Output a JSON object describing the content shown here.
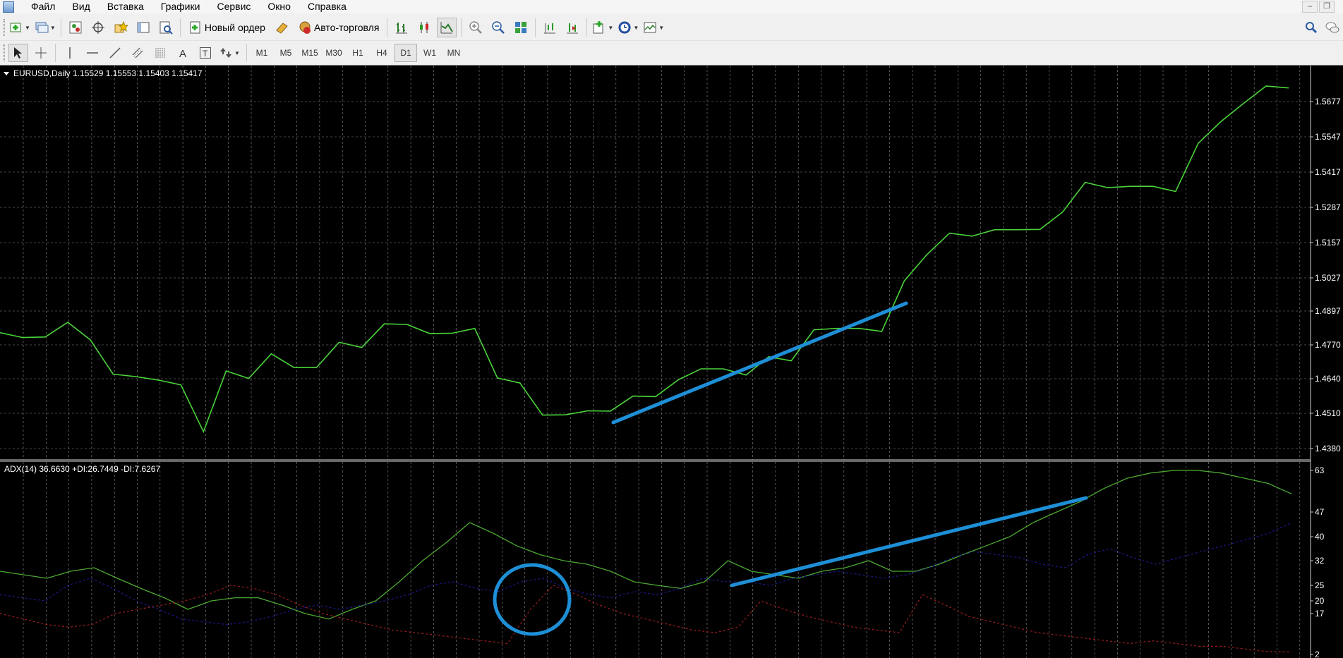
{
  "menu": {
    "items": [
      "Файл",
      "Вид",
      "Вставка",
      "Графики",
      "Сервис",
      "Окно",
      "Справка"
    ]
  },
  "toolbar": {
    "new_order_label": "Новый ордер",
    "auto_trading_label": "Авто-торговля"
  },
  "timeframes": [
    "M1",
    "M5",
    "M15",
    "M30",
    "H1",
    "H4",
    "D1",
    "W1",
    "MN"
  ],
  "active_timeframe": "D1",
  "price_panel": {
    "header": "EURUSD,Daily  1.15529 1.15553 1.15403 1.15417",
    "line_color": "#4ad43a",
    "trendline_color": "#1e8fd6"
  },
  "adx_panel": {
    "header": "ADX(14) 36.6630 +DI:26.7449 -DI:7.6267",
    "adx_color": "#4ca832",
    "plus_di_color": "#1a1a8c",
    "minus_di_color": "#9c1d1d"
  },
  "chart_data": [
    {
      "type": "line",
      "title": "EURUSD,Daily",
      "y_ticks": [
        "1.5677",
        "1.5547",
        "1.5417",
        "1.5287",
        "1.5157",
        "1.5027",
        "1.4897",
        "1.4770",
        "1.4640",
        "1.4510",
        "1.4380"
      ],
      "ylim": [
        1.438,
        1.5677
      ],
      "series": [
        {
          "name": "EURUSD",
          "values": [
            1.4813,
            1.4795,
            1.4797,
            1.4852,
            1.4786,
            1.4658,
            1.4649,
            1.4636,
            1.4618,
            1.4443,
            1.467,
            1.4642,
            1.4734,
            1.4683,
            1.4683,
            1.4777,
            1.4758,
            1.4846,
            1.4844,
            1.481,
            1.4811,
            1.4829,
            1.4644,
            1.4625,
            1.4505,
            1.4506,
            1.4521,
            1.452,
            1.4576,
            1.4574,
            1.4637,
            1.4678,
            1.4678,
            1.4655,
            1.4723,
            1.4708,
            1.4824,
            1.4829,
            1.4829,
            1.4818,
            1.5007,
            1.5105,
            1.5185,
            1.5174,
            1.5198,
            1.5198,
            1.5199,
            1.5264,
            1.5375,
            1.5355,
            1.536,
            1.536,
            1.5341,
            1.5521,
            1.5602,
            1.567,
            1.5735,
            1.5728
          ]
        }
      ],
      "annotations": [
        "blue trend line (rising)"
      ]
    },
    {
      "type": "line",
      "title": "ADX(14) 36.6630 +DI:26.7449 -DI:7.6267",
      "y_ticks": [
        "63",
        "47",
        "40",
        "32",
        "25",
        "20",
        "17",
        "2"
      ],
      "series": [
        {
          "name": "ADX",
          "values": [
            29,
            28,
            27,
            29,
            30,
            27,
            24,
            21,
            18,
            20,
            21,
            21,
            19,
            17,
            15,
            18,
            20,
            26,
            32,
            38,
            44,
            41,
            37,
            34,
            32,
            31,
            29,
            26,
            25,
            24,
            26,
            32,
            29,
            28,
            27,
            29,
            30,
            32,
            29,
            29,
            31,
            34,
            37,
            40,
            44,
            47,
            51,
            56,
            60,
            64,
            63,
            63,
            64,
            66,
            68,
            72
          ]
        },
        {
          "name": "+DI",
          "values": [
            22,
            21,
            20,
            25,
            27,
            24,
            20,
            18,
            15,
            14,
            13,
            14,
            16,
            18,
            19,
            18,
            19,
            20,
            22,
            25,
            26,
            24,
            23,
            26,
            27,
            24,
            22,
            21,
            23,
            22,
            24,
            27,
            26,
            26,
            25,
            27,
            28,
            29,
            28,
            27,
            28,
            30,
            33,
            35,
            34,
            33,
            31,
            30,
            34,
            36,
            33,
            31,
            33,
            35,
            37,
            39,
            41,
            44
          ]
        },
        {
          "name": "-DI",
          "values": [
            17,
            15,
            13,
            12,
            13,
            17,
            18,
            19,
            20,
            22,
            25,
            24,
            22,
            19,
            17,
            15,
            13,
            11,
            10,
            9,
            8,
            7,
            6,
            18,
            25,
            22,
            19,
            17,
            15,
            13,
            11,
            10,
            12,
            20,
            18,
            16,
            14,
            12,
            11,
            10,
            22,
            19,
            16,
            14,
            12,
            10,
            9,
            8,
            7,
            6,
            7,
            6,
            5,
            5,
            4,
            3,
            3
          ]
        }
      ],
      "annotations": [
        "blue trend line (rising)",
        "blue circle"
      ]
    }
  ]
}
